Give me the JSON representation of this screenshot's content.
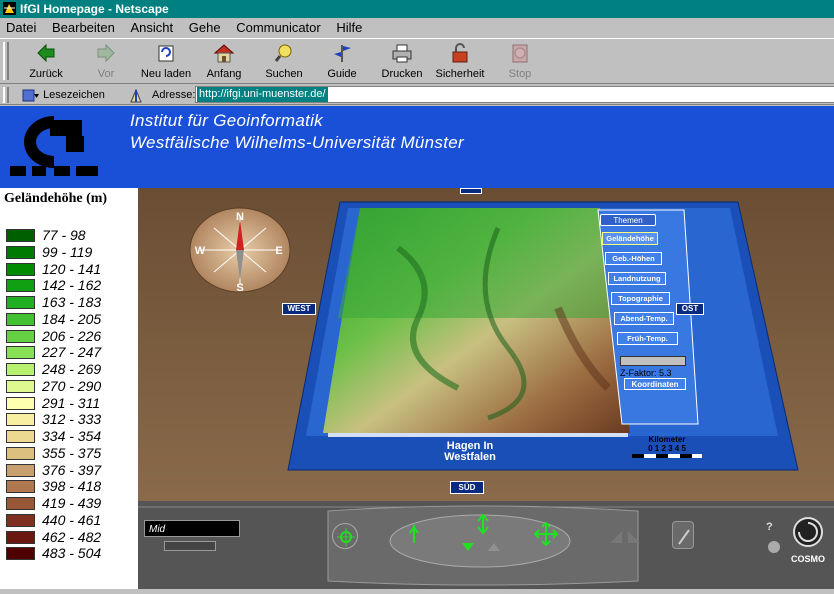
{
  "window": {
    "title": "IfGI Homepage - Netscape"
  },
  "menu": [
    "Datei",
    "Bearbeiten",
    "Ansicht",
    "Gehe",
    "Communicator",
    "Hilfe"
  ],
  "toolbar": [
    {
      "label": "Zurück",
      "icon": "back-arrow-icon",
      "enabled": true
    },
    {
      "label": "Vor",
      "icon": "forward-arrow-icon",
      "enabled": false
    },
    {
      "label": "Neu laden",
      "icon": "reload-icon",
      "enabled": true
    },
    {
      "label": "Anfang",
      "icon": "home-icon",
      "enabled": true
    },
    {
      "label": "Suchen",
      "icon": "search-icon",
      "enabled": true
    },
    {
      "label": "Guide",
      "icon": "guide-icon",
      "enabled": true
    },
    {
      "label": "Drucken",
      "icon": "print-icon",
      "enabled": true
    },
    {
      "label": "Sicherheit",
      "icon": "security-lock-icon",
      "enabled": true
    },
    {
      "label": "Stop",
      "icon": "stop-icon",
      "enabled": false
    }
  ],
  "location": {
    "bookmarks_label": "Lesezeichen",
    "address_label": "Adresse:",
    "url": "http://ifgi.uni-muenster.de/"
  },
  "banner": {
    "line1": "Institut  für  Geoinformatik",
    "line2": "Westfälische Wilhelms-Universität Münster",
    "brand_color": "#1a4fd8"
  },
  "legend": {
    "title": "Geländehöhe (m)",
    "ranges": [
      "77 - 98",
      "99 - 119",
      "120 - 141",
      "142 - 162",
      "163 - 183",
      "184 - 205",
      "206 - 226",
      "227 - 247",
      "248 - 269",
      "270 - 290",
      "291 - 311",
      "312 - 333",
      "334 - 354",
      "355 - 375",
      "376 - 397",
      "398 - 418",
      "419 - 439",
      "440 - 461",
      "462 - 482",
      "483 - 504"
    ],
    "colors": [
      "#006000",
      "#007a00",
      "#008c00",
      "#11a011",
      "#22b022",
      "#44c033",
      "#66d044",
      "#88e055",
      "#b8f070",
      "#e0f890",
      "#ffffb0",
      "#f8f0a0",
      "#ecd890",
      "#dcc080",
      "#c8a070",
      "#b07850",
      "#985838",
      "#803020",
      "#6a1810",
      "#500000"
    ]
  },
  "scene": {
    "compass": {
      "n": "N",
      "s": "S",
      "e": "E",
      "w": "W"
    },
    "labels": {
      "west": "WEST",
      "east": "OST",
      "south": "SÜD"
    },
    "place_label_1": "Hagen In",
    "place_label_2": "Westfalen",
    "themes": {
      "header": "Themen",
      "items": [
        "Geländehöhe",
        "Geb.-Höhen",
        "Landnutzung",
        "Topographie",
        "Abend-Temp.",
        "Früh-Temp."
      ],
      "zfactor": "Z-Faktor: 5.3",
      "coords": "Koordinaten"
    },
    "scale": {
      "label": "Kilometer",
      "ticks": "0 1 2 3 4 5"
    }
  },
  "cosmo": {
    "viewpoint": "Mid",
    "brand": "COSMO"
  }
}
